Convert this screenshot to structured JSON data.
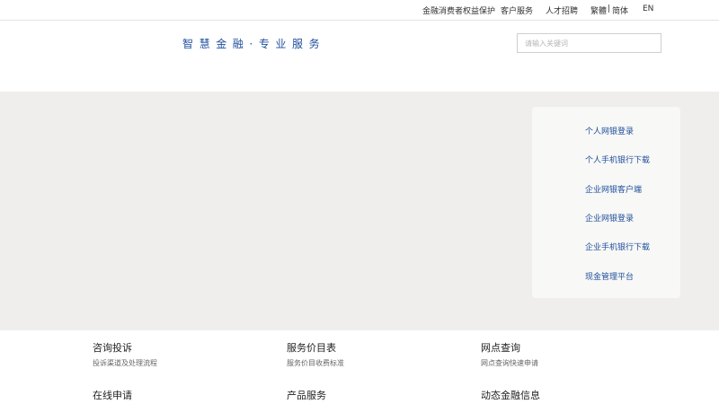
{
  "topbar": {
    "links": [
      "金融消费者权益保护",
      "客户服务",
      "人才招聘"
    ],
    "lang_traditional": "繁體",
    "lang_separator": "|",
    "lang_simplified": "简体",
    "lang_en": "EN"
  },
  "header": {
    "slogan": "智慧金融·专业服务",
    "search_placeholder": "请输入关键词"
  },
  "login_panel": {
    "items": [
      "个人网银登录",
      "个人手机银行下载",
      "企业网银客户端",
      "企业网银登录",
      "企业手机银行下载",
      "现金管理平台"
    ]
  },
  "services": [
    {
      "title": "咨询投诉",
      "desc": "投诉渠道及处理流程"
    },
    {
      "title": "服务价目表",
      "desc": "服务价目收费标准"
    },
    {
      "title": "网点查询",
      "desc": "网点查询快速申请"
    },
    {
      "title": "在线申请",
      "desc": ""
    },
    {
      "title": "产品服务",
      "desc": ""
    },
    {
      "title": "动态金融信息",
      "desc": ""
    }
  ],
  "colors": {
    "accent_blue": "#1f4e9c",
    "hero_background": "#efeeec",
    "panel_background": "#f8f8f6"
  }
}
